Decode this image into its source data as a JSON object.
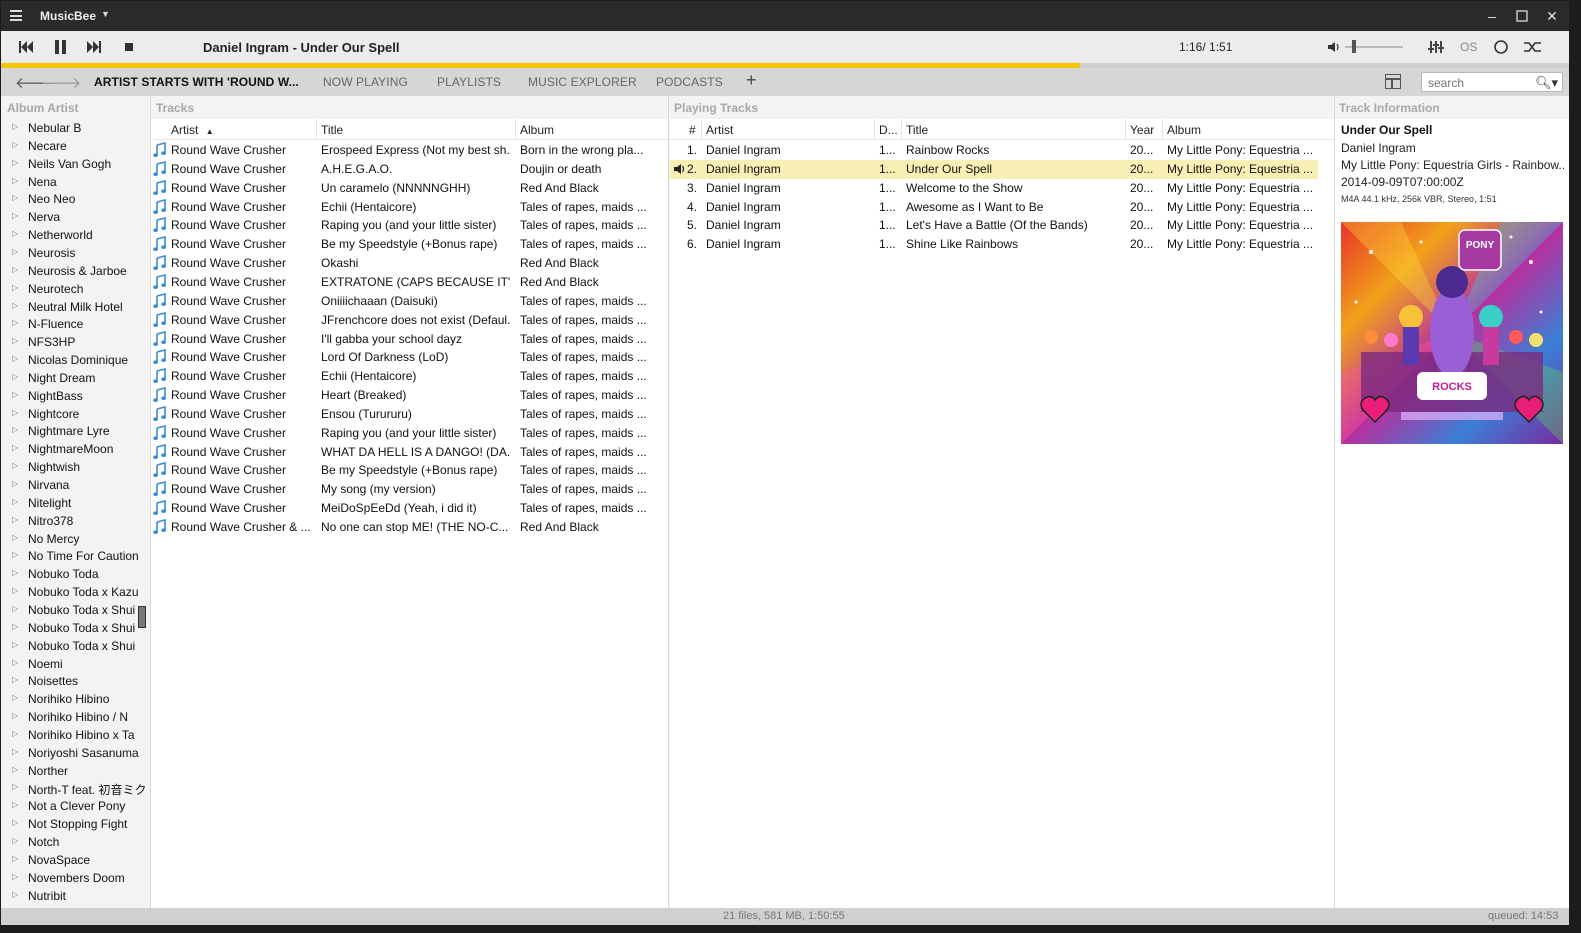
{
  "app": {
    "name": "MusicBee"
  },
  "player": {
    "now_playing": "Daniel Ingram - Under Our Spell",
    "time": "1:16/ 1:51",
    "progress_fraction": 0.688,
    "volume_fraction": 0.15,
    "accent_color": "#f2c600"
  },
  "tabs": [
    {
      "label": "ARTIST STARTS WITH 'ROUND W...",
      "active": true
    },
    {
      "label": "NOW PLAYING"
    },
    {
      "label": "PLAYLISTS"
    },
    {
      "label": "MUSIC EXPLORER"
    },
    {
      "label": "PODCASTS"
    }
  ],
  "tab_add": "+",
  "search": {
    "placeholder": "search"
  },
  "panels": {
    "album_artist": "Album Artist",
    "tracks": "Tracks",
    "playing": "Playing Tracks",
    "info": "Track Information"
  },
  "album_artists": [
    "Nebular B",
    "Necare",
    "Neils Van Gogh",
    "Nena",
    "Neo Neo",
    "Nerva",
    "Netherworld",
    "Neurosis",
    "Neurosis & Jarboe",
    "Neurotech",
    "Neutral Milk Hotel",
    "N-Fluence",
    "NFS3HP",
    "Nicolas Dominique",
    "Night Dream",
    "NightBass",
    "Nightcore",
    "Nightmare Lyre",
    "NightmareMoon",
    "Nightwish",
    "Nirvana",
    "Nitelight",
    "Nitro378",
    "No Mercy",
    "No Time For Caution",
    "Nobuko Toda",
    "Nobuko Toda x Kazu",
    "Nobuko Toda x Shui",
    "Nobuko Toda x Shui",
    "Nobuko Toda x Shui",
    "Noemi",
    "Noisettes",
    "Norihiko Hibino",
    "Norihiko Hibino / N",
    "Norihiko Hibino x Ta",
    "Noriyoshi Sasanuma",
    "Norther",
    "North-T feat. 初音ミク",
    "Not a Clever Pony",
    "Not Stopping Fight",
    "Notch",
    "NovaSpace",
    "Novembers Doom",
    "Nutribit"
  ],
  "tracks": {
    "headers": {
      "artist": "Artist",
      "title": "Title",
      "album": "Album",
      "sort_indicator": "▲"
    },
    "rows": [
      {
        "artist": "Round Wave Crusher",
        "title": "Erospeed Express (Not my best sh...",
        "album": "Born in the wrong pla..."
      },
      {
        "artist": "Round Wave Crusher",
        "title": "A.H.E.G.A.O.",
        "album": "Doujin or death"
      },
      {
        "artist": "Round Wave Crusher",
        "title": "Un caramelo (NNNNNGHH)",
        "album": "Red And Black"
      },
      {
        "artist": "Round Wave Crusher",
        "title": "Echii (Hentaicore)",
        "album": "Tales of rapes, maids ..."
      },
      {
        "artist": "Round Wave Crusher",
        "title": "Raping you (and your little sister)",
        "album": "Tales of rapes, maids ..."
      },
      {
        "artist": "Round Wave Crusher",
        "title": "Be my Speedstyle (+Bonus rape)",
        "album": "Tales of rapes, maids ..."
      },
      {
        "artist": "Round Wave Crusher",
        "title": "Okashi",
        "album": "Red And Black"
      },
      {
        "artist": "Round Wave Crusher",
        "title": "EXTRATONE (CAPS BECAUSE IT'S ...",
        "album": "Red And Black"
      },
      {
        "artist": "Round Wave Crusher",
        "title": "Oniiiichaaan (Daisuki)",
        "album": "Tales of rapes, maids ..."
      },
      {
        "artist": "Round Wave Crusher",
        "title": "JFrenchcore does not exist (Defaul...",
        "album": "Tales of rapes, maids ..."
      },
      {
        "artist": "Round Wave Crusher",
        "title": "I'll gabba your school dayz",
        "album": "Tales of rapes, maids ..."
      },
      {
        "artist": "Round Wave Crusher",
        "title": "Lord Of Darkness (LoD)",
        "album": "Tales of rapes, maids ..."
      },
      {
        "artist": "Round Wave Crusher",
        "title": "Echii (Hentaicore)",
        "album": "Tales of rapes, maids ..."
      },
      {
        "artist": "Round Wave Crusher",
        "title": "Heart (Breaked)",
        "album": "Tales of rapes, maids ..."
      },
      {
        "artist": "Round Wave Crusher",
        "title": "Ensou (Turururu)",
        "album": "Tales of rapes, maids ..."
      },
      {
        "artist": "Round Wave Crusher",
        "title": "Raping you (and your little sister)",
        "album": "Tales of rapes, maids ..."
      },
      {
        "artist": "Round Wave Crusher",
        "title": "WHAT DA HELL IS A DANGO! (DA...",
        "album": "Tales of rapes, maids ..."
      },
      {
        "artist": "Round Wave Crusher",
        "title": "Be my Speedstyle (+Bonus rape)",
        "album": "Tales of rapes, maids ..."
      },
      {
        "artist": "Round Wave Crusher",
        "title": "My song (my version)",
        "album": "Tales of rapes, maids ..."
      },
      {
        "artist": "Round Wave Crusher",
        "title": "MeiDoSpEeDd (Yeah, i did it)",
        "album": "Tales of rapes, maids ..."
      },
      {
        "artist": "Round Wave Crusher & ...",
        "title": "No one can stop ME! (THE NO-C...",
        "album": "Red And Black"
      }
    ]
  },
  "playing": {
    "headers": {
      "num": "#",
      "artist": "Artist",
      "disc": "D...",
      "title": "Title",
      "year": "Year",
      "album": "Album"
    },
    "rows": [
      {
        "num": "1.",
        "artist": "Daniel Ingram",
        "disc": "1...",
        "title": "Rainbow Rocks",
        "year": "20...",
        "album": "My Little Pony: Equestria ..."
      },
      {
        "num": "2.",
        "artist": "Daniel Ingram",
        "disc": "1...",
        "title": "Under Our Spell",
        "year": "20...",
        "album": "My Little Pony: Equestria ...",
        "playing": true
      },
      {
        "num": "3.",
        "artist": "Daniel Ingram",
        "disc": "1...",
        "title": "Welcome to the Show",
        "year": "20...",
        "album": "My Little Pony: Equestria ..."
      },
      {
        "num": "4.",
        "artist": "Daniel Ingram",
        "disc": "1...",
        "title": "Awesome as I Want to Be",
        "year": "20...",
        "album": "My Little Pony: Equestria ..."
      },
      {
        "num": "5.",
        "artist": "Daniel Ingram",
        "disc": "1...",
        "title": "Let's Have a Battle (Of the Bands)",
        "year": "20...",
        "album": "My Little Pony: Equestria ..."
      },
      {
        "num": "6.",
        "artist": "Daniel Ingram",
        "disc": "1...",
        "title": "Shine Like Rainbows",
        "year": "20...",
        "album": "My Little Pony: Equestria ..."
      }
    ]
  },
  "info": {
    "title": "Under Our Spell",
    "artist": "Daniel Ingram",
    "album": "My Little Pony: Equestria Girls - Rainbow...",
    "date": "2014-09-09T07:00:00Z",
    "tech": "M4A 44.1 kHz, 256k VBR, Stereo, 1:51"
  },
  "status": {
    "summary": "21 files, 581 MB, 1:50:55",
    "queued": "queued: 14:53"
  }
}
